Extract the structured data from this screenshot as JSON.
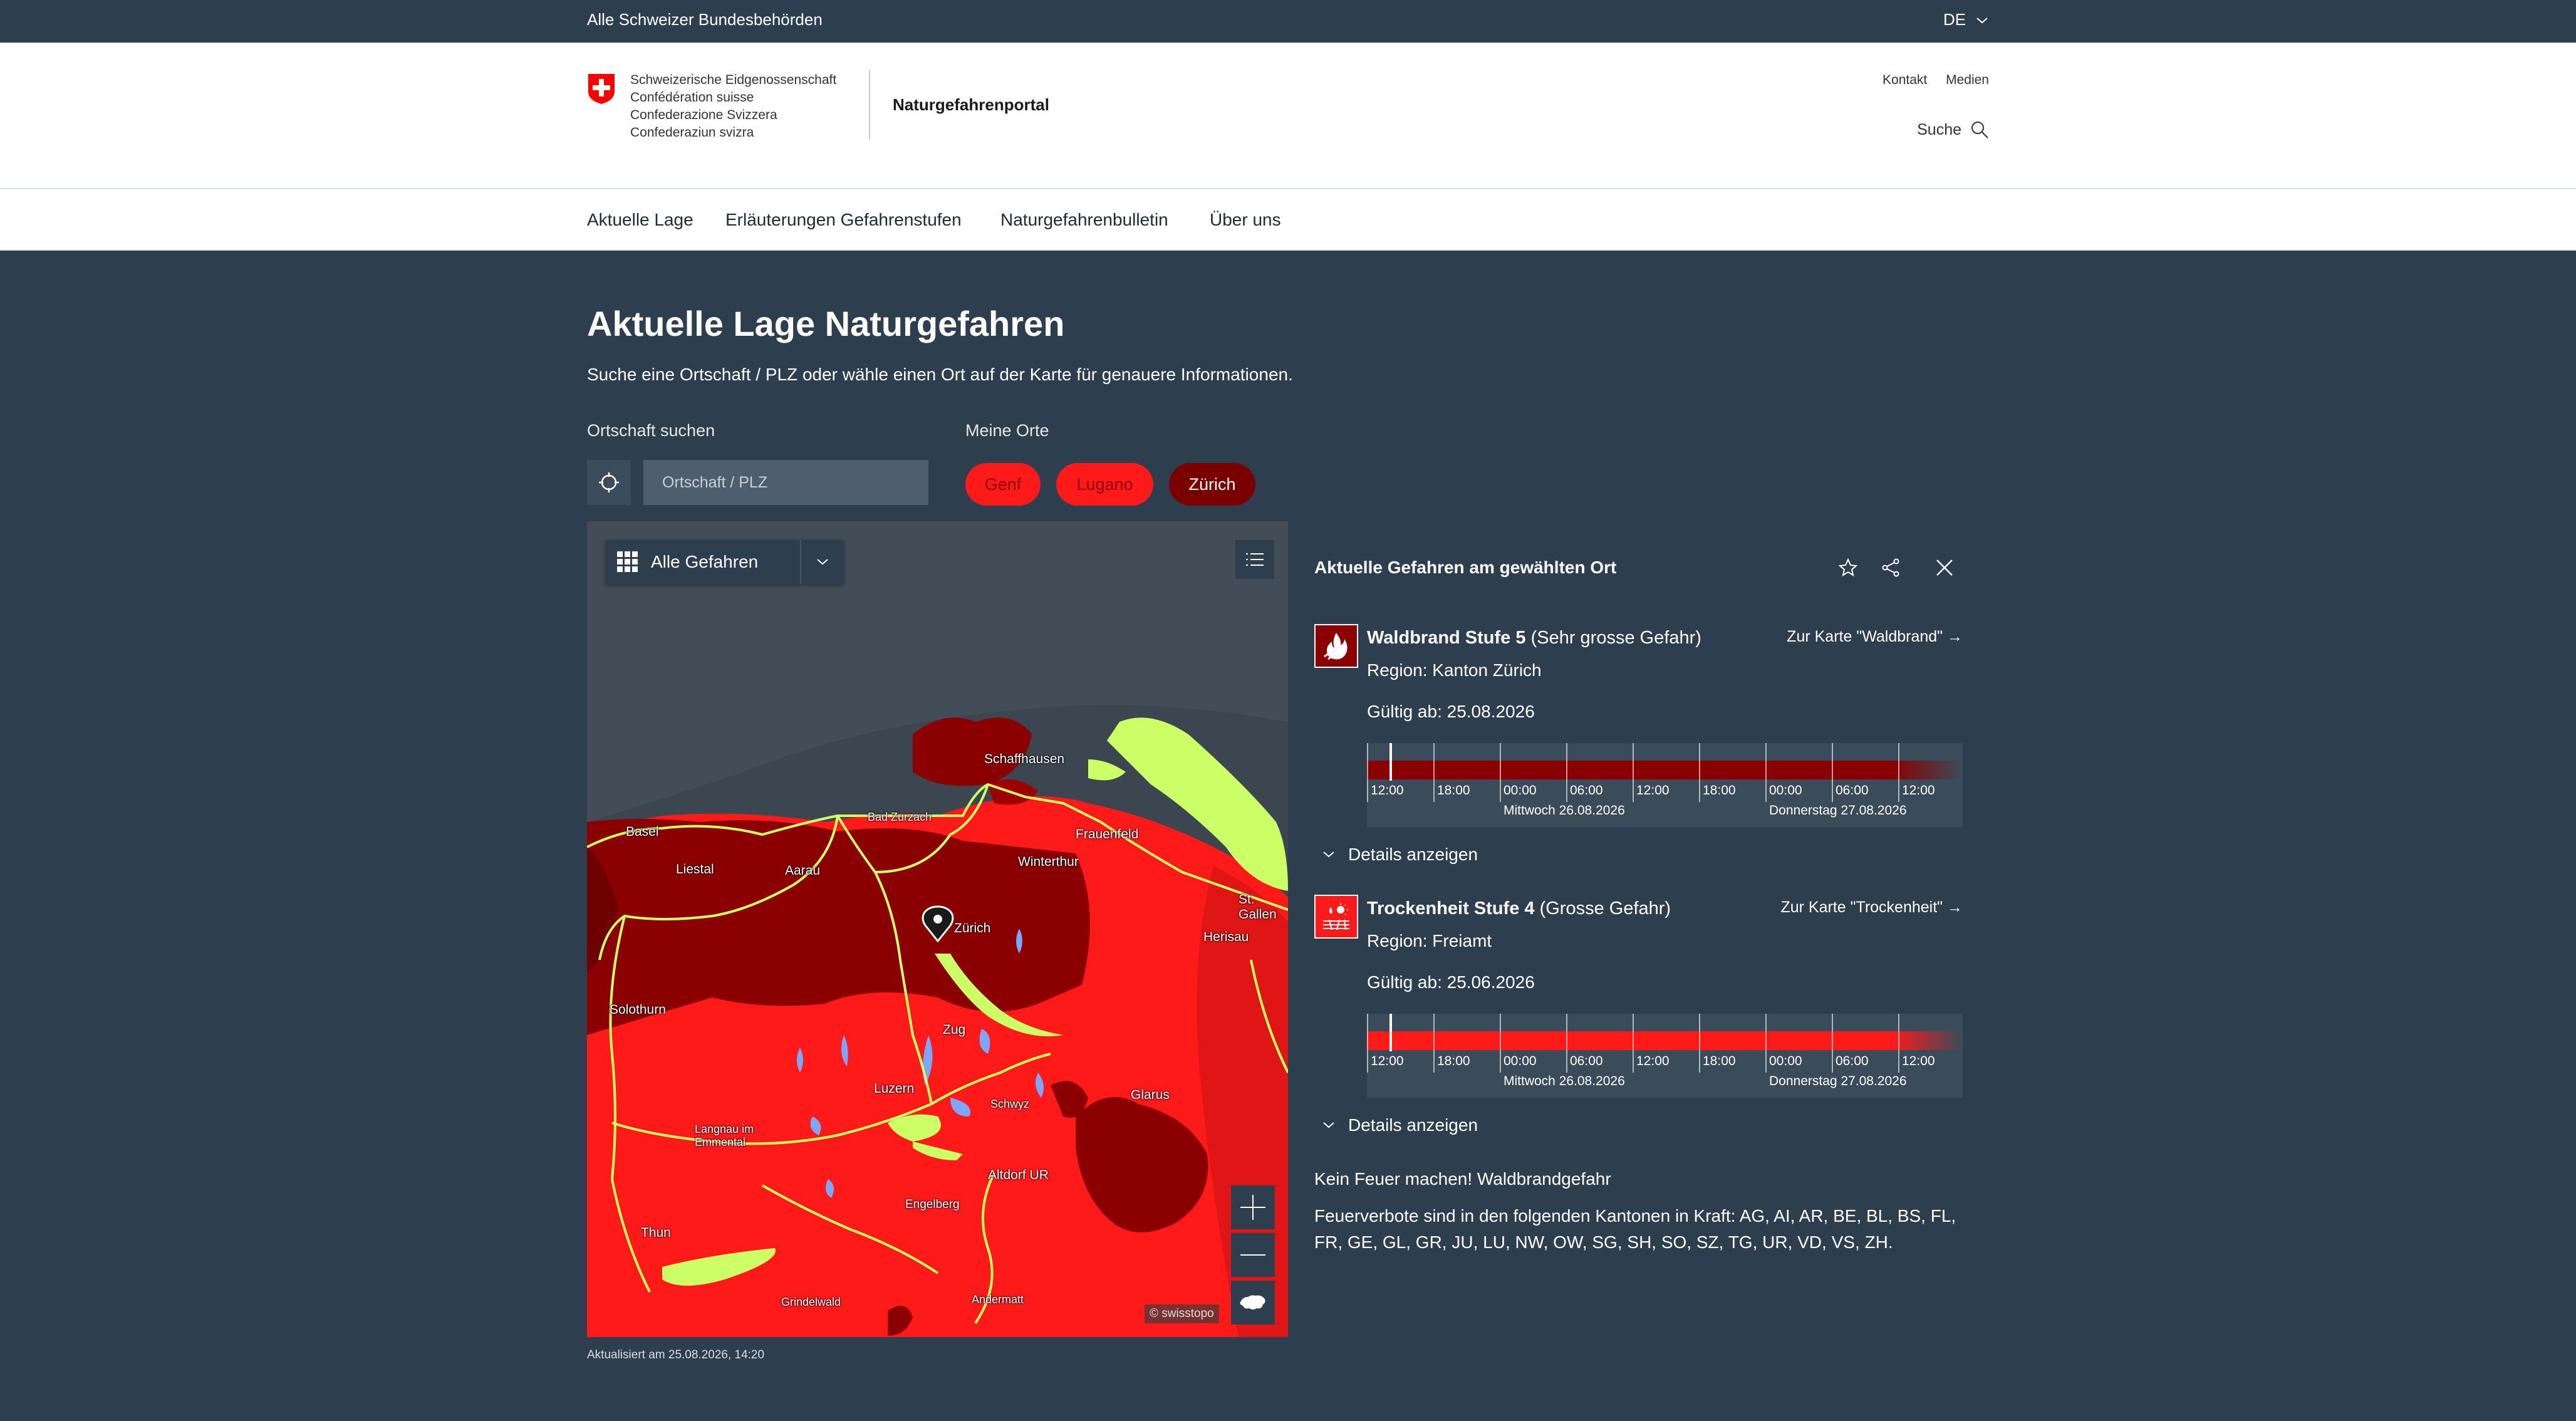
{
  "topbar": {
    "all_authorities": "Alle Schweizer Bundesbehörden",
    "language": "DE"
  },
  "header": {
    "confed_lines": [
      "Schweizerische Eidgenossenschaft",
      "Confédération suisse",
      "Confederazione Svizzera",
      "Confederaziun svizra"
    ],
    "portal_name": "Naturgefahrenportal",
    "links": [
      "Kontakt",
      "Medien"
    ],
    "search_label": "Suche"
  },
  "nav": {
    "items": [
      "Aktuelle Lage",
      "Erläuterungen Gefahrenstufen",
      "Naturgefahrenbulletin",
      "Über uns"
    ]
  },
  "main": {
    "title": "Aktuelle Lage Naturgefahren",
    "lead": "Suche eine Ortschaft / PLZ oder wähle einen Ort auf der Karte für genauere Informationen.",
    "search_label": "Ortschaft suchen",
    "search_placeholder": "Ortschaft / PLZ",
    "places_label": "Meine Orte",
    "places": [
      "Genf",
      "Lugano",
      "Zürich"
    ]
  },
  "map": {
    "filter_label": "Alle Gefahren",
    "copyright": "© swisstopo",
    "cities": [
      "Schaffhausen",
      "Bad Zurzach",
      "Frauenfeld",
      "Basel",
      "Liestal",
      "Winterthur",
      "Aarau",
      "Zürich",
      "St. Gallen",
      "Herisau",
      "Solothurn",
      "Zug",
      "Luzern",
      "Schwyz",
      "Glarus",
      "Langnau im Emmental",
      "Altdorf UR",
      "Engelberg",
      "Thun",
      "Grindelwald",
      "Andermatt"
    ]
  },
  "panel": {
    "title": "Aktuelle Gefahren am gewählten Ort",
    "hazards": [
      {
        "name": "Waldbrand Stufe 5",
        "level_text": "(Sehr grosse Gefahr)",
        "link": "Zur Karte \"Waldbrand\"",
        "region": "Region: Kanton Zürich",
        "valid": "Gültig ab: 25.08.2026",
        "bar_color": "#8b0000",
        "details": "Details anzeigen"
      },
      {
        "name": "Trockenheit Stufe 4",
        "level_text": "(Grosse Gefahr)",
        "link": "Zur Karte \"Trockenheit\"",
        "region": "Region: Freiamt",
        "valid": "Gültig ab: 25.06.2026",
        "bar_color": "#ff1a1a",
        "details": "Details anzeigen"
      }
    ],
    "timeline": {
      "times": [
        "12:00",
        "18:00",
        "00:00",
        "06:00",
        "12:00",
        "18:00",
        "00:00",
        "06:00",
        "12:00"
      ],
      "day1": "Mittwoch 26.08.2026",
      "day2": "Donnerstag 27.08.2026"
    },
    "notice_title": "Kein Feuer machen! Waldbrandgefahr",
    "notice_text": "Feuerverbote sind in den folgenden Kantonen in Kraft: AG, AI, AR, BE, BL, BS, FL, FR, GE, GL, GR, JU, LU, NW, OW, SG, SH, SO, SZ, TG, UR, VD, VS, ZH."
  },
  "footer": {
    "updated": "Aktualisiert am 25.08.2026, 14:20"
  }
}
